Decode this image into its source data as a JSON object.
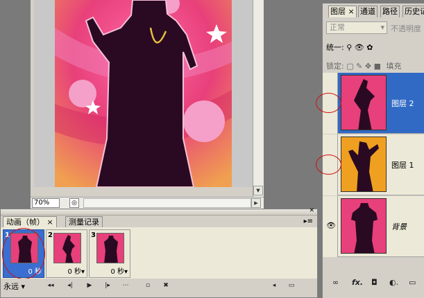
{
  "document": {
    "zoom": "70%"
  },
  "animation_panel": {
    "tabs": [
      {
        "label": "动画（帧）"
      },
      {
        "label": "测量记录"
      }
    ],
    "tab_close": "×",
    "frames": [
      {
        "number": "1",
        "delay": "0 秒"
      },
      {
        "number": "2",
        "delay": "0 秒▾"
      },
      {
        "number": "3",
        "delay": "0 秒▾"
      }
    ],
    "loop": "永远"
  },
  "layers_panel": {
    "tabs": [
      {
        "label": "图层"
      },
      {
        "label": "通道"
      },
      {
        "label": "路径"
      },
      {
        "label": "历史记"
      }
    ],
    "tab_close": "×",
    "blend_mode": "正常",
    "opacity_label": "不透明度",
    "unify_label": "统一:",
    "lock_label": "锁定:",
    "fill_label": "填充",
    "layers": [
      {
        "name": "图层 2",
        "selected": true,
        "visible": false
      },
      {
        "name": "图层 1",
        "selected": false,
        "visible": false
      },
      {
        "name": "背景",
        "selected": false,
        "visible": true
      }
    ],
    "bottom_buttons": [
      "∞",
      "fx.",
      "◘",
      "◐.",
      "▭"
    ]
  },
  "colors": {
    "selection_blue": "#316ac5",
    "highlight_red": "#d01010",
    "poster_pink": "#e8407a",
    "silhouette": "#2a0a22"
  }
}
